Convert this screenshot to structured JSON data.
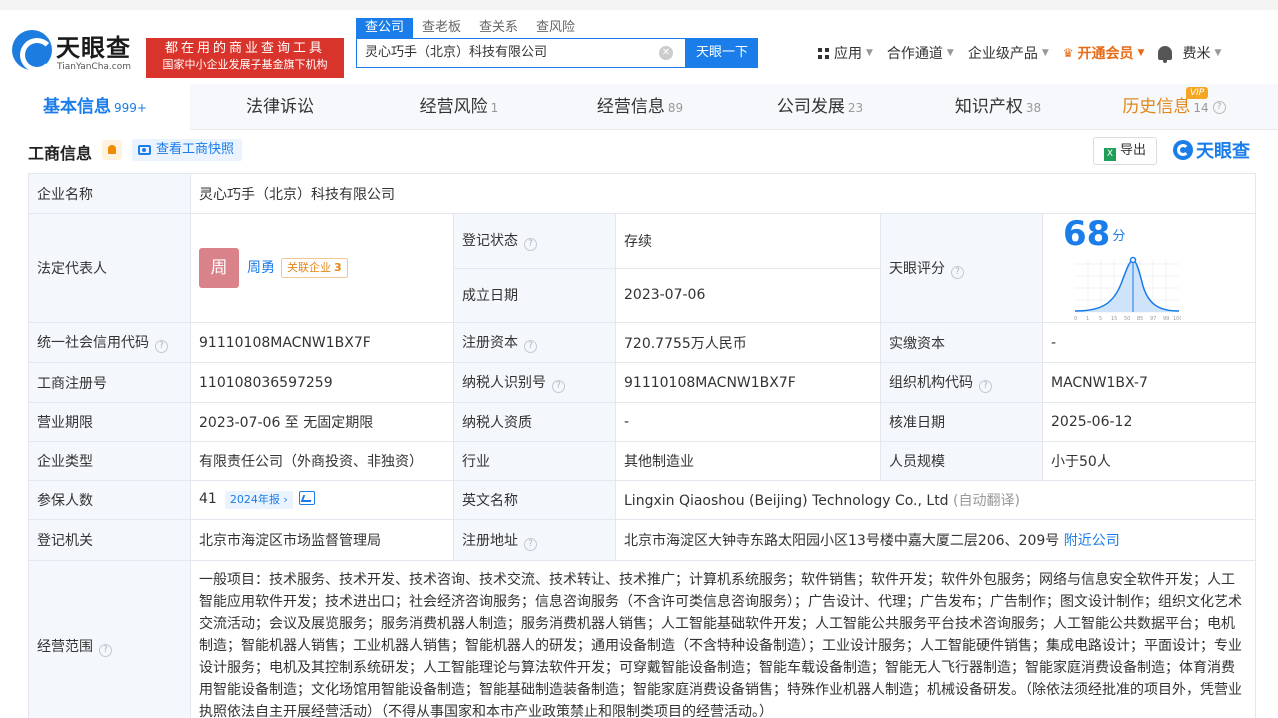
{
  "header": {
    "logo_text": "天眼查",
    "logo_sub": "TianYanCha.com",
    "promo_line1": "都在用的商业查询工具",
    "promo_line2": "国家中小企业发展子基金旗下机构",
    "search_tabs": [
      "查公司",
      "查老板",
      "查关系",
      "查风险"
    ],
    "search_value": "灵心巧手（北京）科技有限公司",
    "search_button": "天眼一下",
    "nav": {
      "apps": "应用",
      "channel": "合作通道",
      "enterprise": "企业级产品",
      "vip": "开通会员",
      "user": "费米"
    }
  },
  "tabs": [
    {
      "label": "基本信息",
      "count": "999+"
    },
    {
      "label": "法律诉讼",
      "count": ""
    },
    {
      "label": "经营风险",
      "count": "1"
    },
    {
      "label": "经营信息",
      "count": "89"
    },
    {
      "label": "公司发展",
      "count": "23"
    },
    {
      "label": "知识产权",
      "count": "38"
    },
    {
      "label": "历史信息",
      "count": "14",
      "badge": "VIP"
    }
  ],
  "section": {
    "title": "工商信息",
    "snapshot": "查看工商快照",
    "export": "导出",
    "brand": "天眼查"
  },
  "info": {
    "company_name_label": "企业名称",
    "company_name": "灵心巧手（北京）科技有限公司",
    "legal_rep_label": "法定代表人",
    "legal_rep_avatar": "周",
    "legal_rep_name": "周勇",
    "related_label": "关联企业",
    "related_count": "3",
    "reg_status_label": "登记状态",
    "reg_status": "存续",
    "founded_label": "成立日期",
    "founded": "2023-07-06",
    "score_label": "天眼评分",
    "score": "68",
    "score_unit": "分",
    "score_ticks": [
      "0",
      "1",
      "5",
      "15",
      "50",
      "85",
      "97",
      "99",
      "100"
    ],
    "credit_code_label": "统一社会信用代码",
    "credit_code": "91110108MACNW1BX7F",
    "reg_capital_label": "注册资本",
    "reg_capital": "720.7755万人民币",
    "paid_capital_label": "实缴资本",
    "paid_capital": "-",
    "reg_no_label": "工商注册号",
    "reg_no": "110108036597259",
    "taxpayer_id_label": "纳税人识别号",
    "taxpayer_id": "91110108MACNW1BX7F",
    "org_code_label": "组织机构代码",
    "org_code": "MACNW1BX-7",
    "term_label": "营业期限",
    "term": "2023-07-06 至 无固定期限",
    "tax_qual_label": "纳税人资质",
    "tax_qual": "-",
    "approve_label": "核准日期",
    "approve": "2025-06-12",
    "type_label": "企业类型",
    "type": "有限责任公司（外商投资、非独资）",
    "industry_label": "行业",
    "industry": "其他制造业",
    "staff_label": "人员规模",
    "staff": "小于50人",
    "insured_label": "参保人数",
    "insured": "41",
    "insured_report": "2024年报",
    "en_name_label": "英文名称",
    "en_name": "Lingxin Qiaoshou (Beijing) Technology Co., Ltd",
    "en_name_note": "(自动翻译)",
    "authority_label": "登记机关",
    "authority": "北京市海淀区市场监督管理局",
    "address_label": "注册地址",
    "address": "北京市海淀区大钟寺东路太阳园小区13号楼中嘉大厦二层206、209号",
    "nearby": "附近公司",
    "scope_label": "经营范围",
    "scope": "一般项目：技术服务、技术开发、技术咨询、技术交流、技术转让、技术推广；计算机系统服务；软件销售；软件开发；软件外包服务；网络与信息安全软件开发；人工智能应用软件开发；技术进出口；社会经济咨询服务；信息咨询服务（不含许可类信息咨询服务）；广告设计、代理；广告发布；广告制作；图文设计制作；组织文化艺术交流活动；会议及展览服务；服务消费机器人制造；服务消费机器人销售；人工智能基础软件开发；人工智能公共服务平台技术咨询服务；人工智能公共数据平台；电机制造；智能机器人销售；工业机器人销售；智能机器人的研发；通用设备制造（不含特种设备制造）；工业设计服务；人工智能硬件销售；集成电路设计；平面设计；专业设计服务；电机及其控制系统研发；人工智能理论与算法软件开发；可穿戴智能设备制造；智能车载设备制造；智能无人飞行器制造；智能家庭消费设备制造；体育消费用智能设备制造；文化场馆用智能设备制造；智能基础制造装备制造；智能家庭消费设备销售；特殊作业机器人制造；机械设备研发。（除依法须经批准的项目外，凭营业执照依法自主开展经营活动）（不得从事国家和本市产业政策禁止和限制类项目的经营活动。）"
  }
}
